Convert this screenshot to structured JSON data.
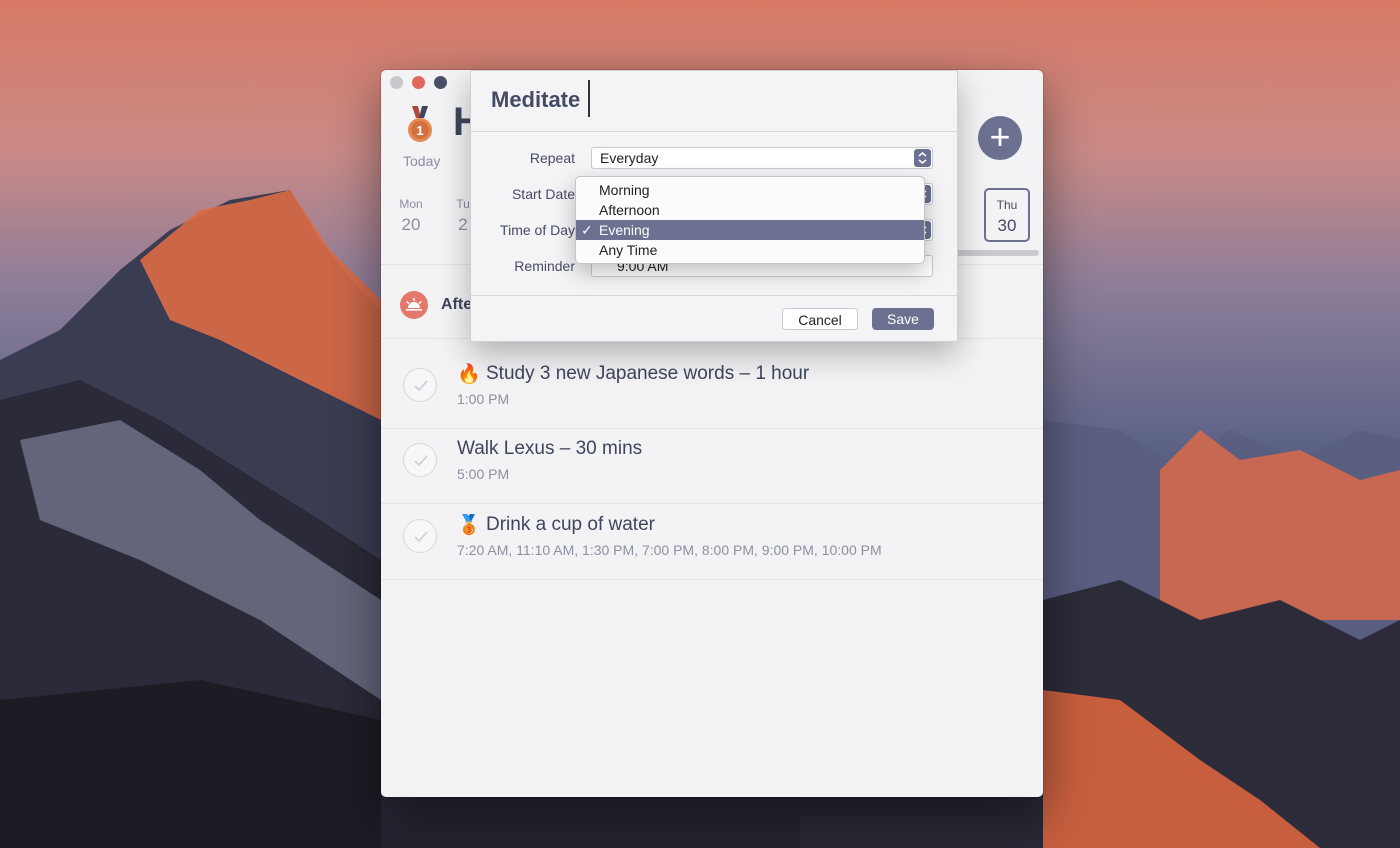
{
  "window": {
    "title_partial": "H",
    "today_label": "Today"
  },
  "week": {
    "mon": {
      "name": "Mon",
      "num": "20"
    },
    "tue": {
      "name": "Tu",
      "num": "2"
    },
    "thu": {
      "name": "Thu",
      "num": "30"
    }
  },
  "section": {
    "label": "Afte"
  },
  "tasks": [
    {
      "emoji": "🔥",
      "title": "Study 3 new Japanese words – 1 hour",
      "time": "1:00 PM"
    },
    {
      "emoji": "",
      "title": "Walk Lexus – 30 mins",
      "time": "5:00 PM"
    },
    {
      "emoji": "🥉",
      "title": "Drink a cup of water",
      "time": "7:20 AM, 11:10 AM, 1:30 PM, 7:00 PM, 8:00 PM, 9:00 PM, 10:00 PM"
    }
  ],
  "sheet": {
    "name": "Meditate",
    "repeat_label": "Repeat",
    "repeat_value": "Everyday",
    "start_date_label": "Start Date",
    "time_of_day_label": "Time of Day",
    "reminder_label": "Reminder",
    "reminder_value": "9:00 AM",
    "cancel": "Cancel",
    "save": "Save"
  },
  "menu": {
    "items": [
      "Morning",
      "Afternoon",
      "Evening",
      "Any Time"
    ],
    "selected": "Evening",
    "checkmark": "✓"
  },
  "add_symbol": "+",
  "colors": {
    "accent": "#6c7191",
    "section_icon": "#e4786a"
  }
}
